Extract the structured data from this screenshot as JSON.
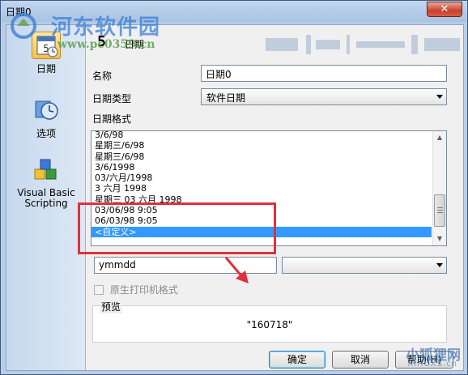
{
  "window": {
    "title": "日期0",
    "close_symbol": "✕"
  },
  "watermark": {
    "site_name": "河东软件园",
    "site_url": "www.pc0359.cn",
    "bottom_name": "小狐狸网",
    "bottom_url": "XIHUXS.cn"
  },
  "sidebar": {
    "items": [
      {
        "label": "日期",
        "icon": "calendar-icon",
        "selected": true
      },
      {
        "label": "选项",
        "icon": "clock-options-icon",
        "selected": false
      },
      {
        "label": "Visual Basic Scripting",
        "label_line1": "Visual Basic",
        "label_line2": "Scripting",
        "icon": "blocks-icon",
        "selected": false
      }
    ]
  },
  "header": {
    "icon_text": "5",
    "title": "日期"
  },
  "form": {
    "name_label": "名称",
    "name_value": "日期0",
    "type_label": "日期类型",
    "type_value": "软件日期",
    "format_label": "日期格式",
    "formats": [
      "3/6/98",
      "星期三/6/98",
      "星期三/6/98",
      "3/6/1998",
      "03/六月/1998",
      "3 六月 1998",
      "星期三 03 六月 1998",
      "03/06/98 9:05",
      "06/03/98 9:05",
      "<自定义>"
    ],
    "selected_format": "<自定义>",
    "custom_value": "ymmdd",
    "custom_select_value": "",
    "printer_checkbox_label": "原生打印机格式",
    "preview_label": "预览",
    "preview_value": "\"160718\""
  },
  "buttons": {
    "ok": "确定",
    "cancel": "取消",
    "help": "帮助(H)"
  },
  "colors": {
    "selection": "#3399ff",
    "highlight_box": "#e0303b",
    "title_gradient_top": "#c3d6ec"
  }
}
